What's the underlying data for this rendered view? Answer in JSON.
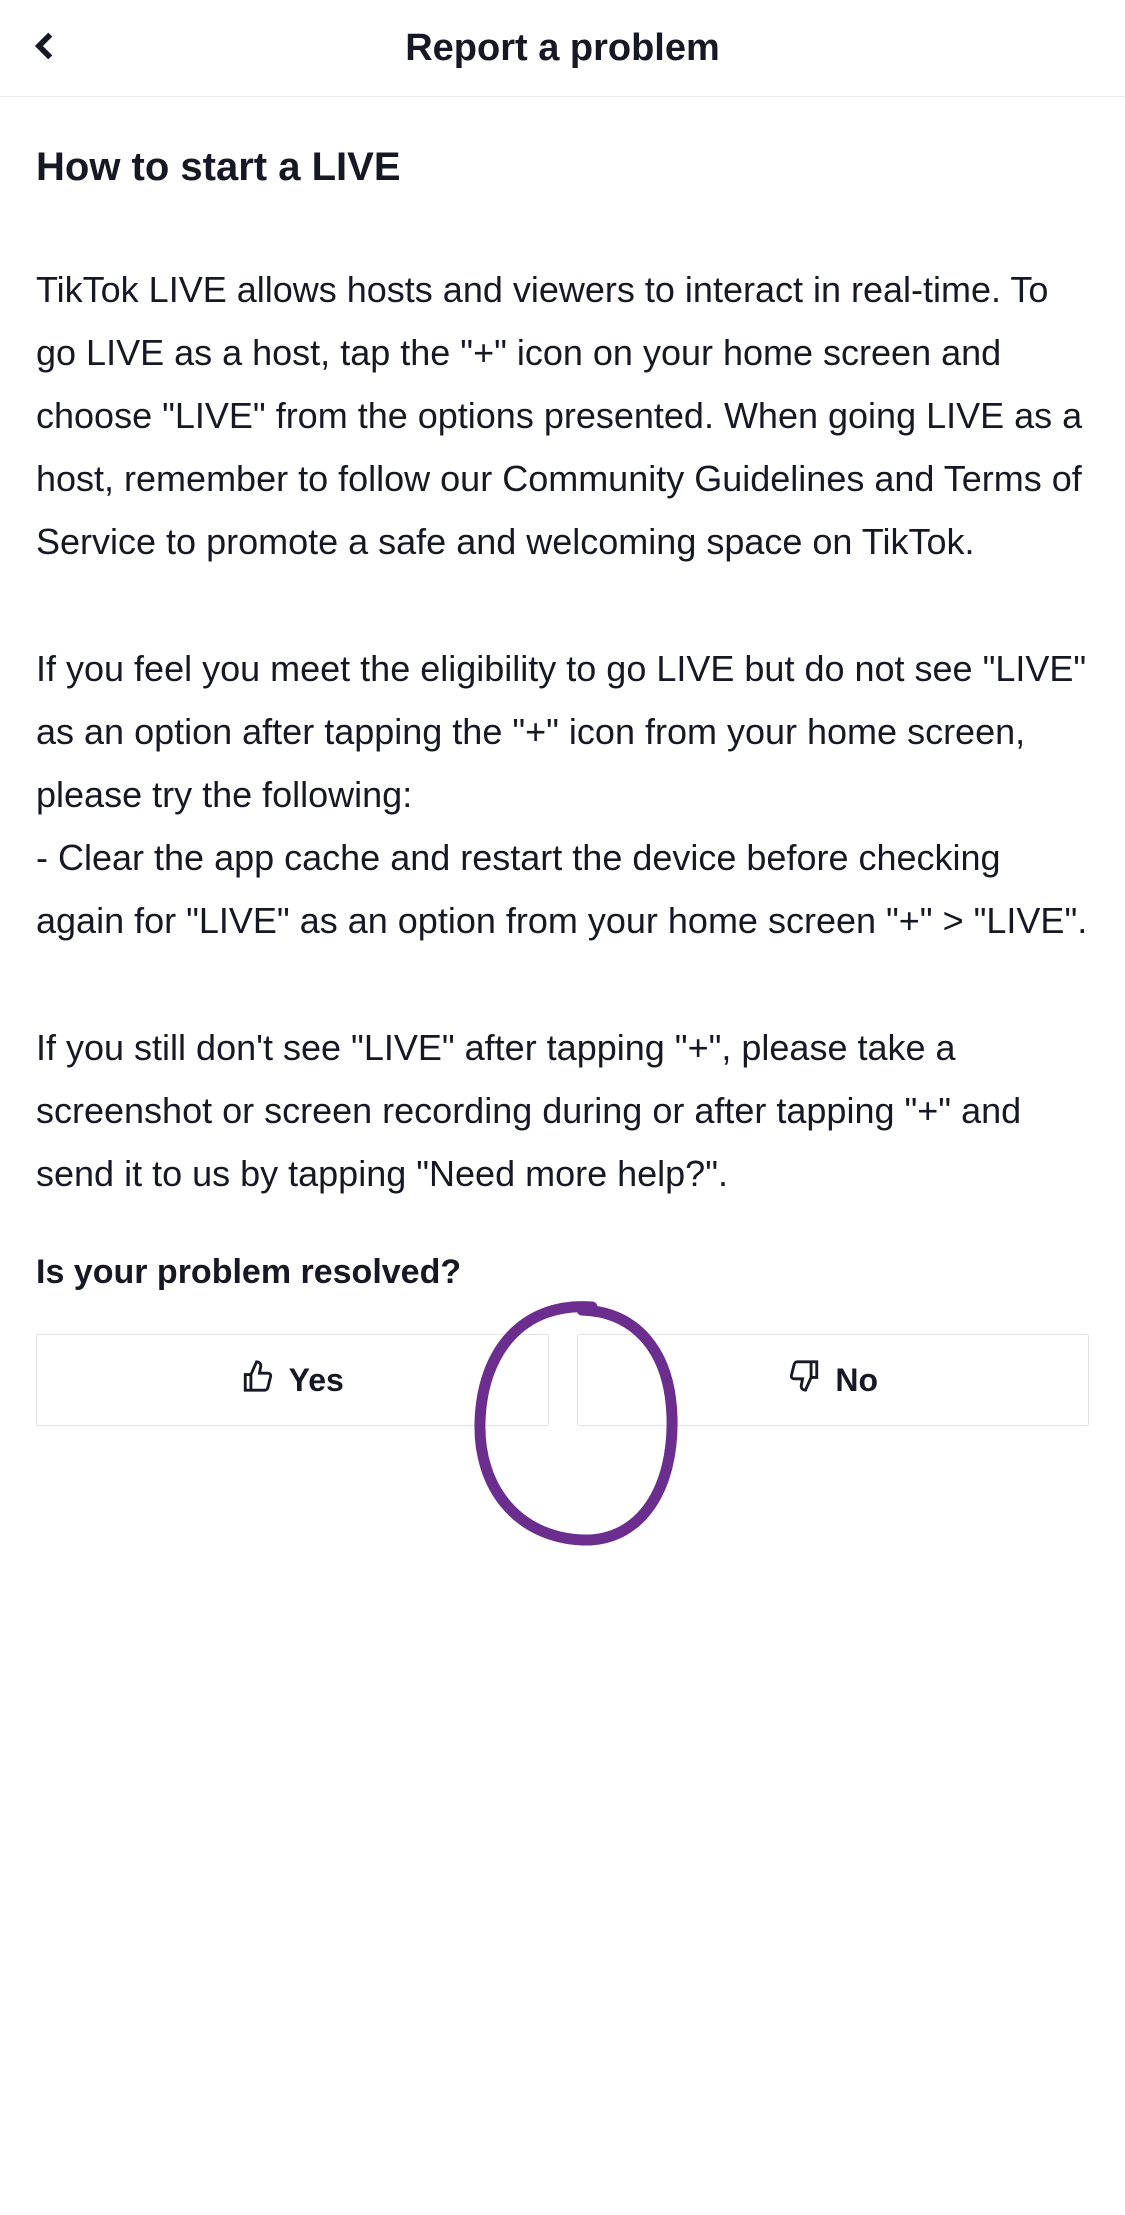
{
  "header": {
    "title": "Report a problem"
  },
  "article": {
    "title": "How to start a LIVE",
    "paragraphs": [
      "TikTok LIVE allows hosts and viewers to interact in real-time. To go LIVE as a host, tap the \"+\" icon on your home screen and choose \"LIVE\" from the options presented. When going LIVE as a host, remember to follow our Community Guidelines and Terms of Service to promote a safe and welcoming space on TikTok.",
      "If you feel you meet the eligibility to go LIVE but do not see \"LIVE\" as an option after tapping the \"+\" icon from your home screen, please try the following:\n- Clear the app cache and restart the device before checking again for \"LIVE\" as an option from your home screen \"+\" > \"LIVE\".",
      "If you still don't see \"LIVE\" after tapping \"+\", please take a screenshot or screen recording during or after tapping \"+\" and send it to us by tapping \"Need more help?\"."
    ]
  },
  "feedback": {
    "question": "Is your problem resolved?",
    "yes_label": "Yes",
    "no_label": "No"
  }
}
